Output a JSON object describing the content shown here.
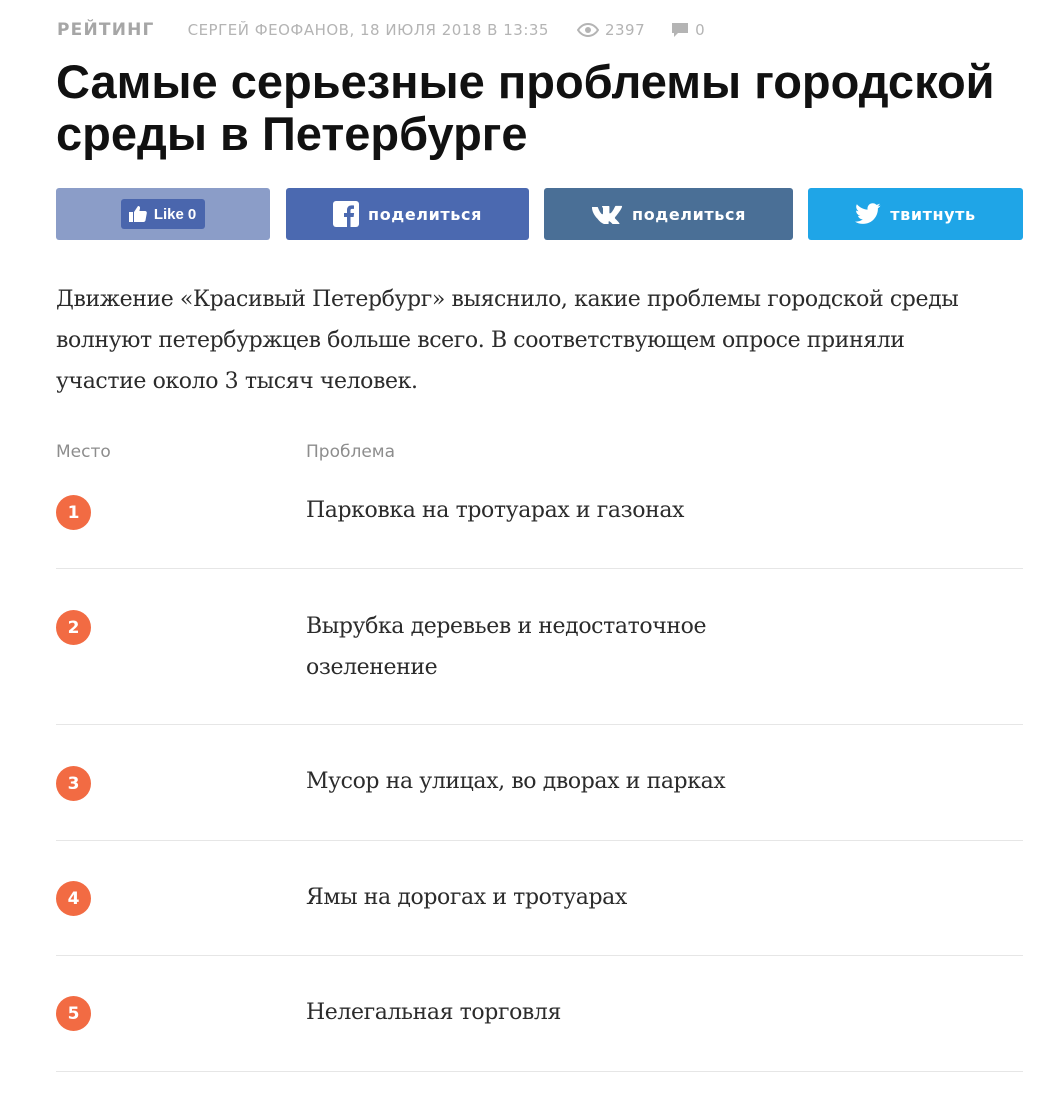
{
  "meta": {
    "category": "РЕЙТИНГ",
    "author_date": "СЕРГЕЙ ФЕОФАНОВ, 18 ИЮЛЯ 2018 В 13:35",
    "views": "2397",
    "comments": "0",
    "views_icon": "eye-icon",
    "comments_icon": "speech-bubble-icon"
  },
  "article": {
    "title": "Самые серьезные проблемы городской среды в Петербурге",
    "lead": "Движение «Красивый Петербург» выяснило, какие проблемы городской среды волнуют петербуржцев больше всего. В соответствующем опросе приняли участие около 3 тысяч человек."
  },
  "share": {
    "like_label": "Like",
    "like_count": "0",
    "facebook_label": "поделиться",
    "vk_label": "поделиться",
    "twitter_label": "твитнуть",
    "colors": {
      "like": "#8b9dc8",
      "facebook": "#4b69b0",
      "vk": "#4a6f96",
      "twitter": "#1fa5e7"
    }
  },
  "table": {
    "headers": [
      "Место",
      "Проблема"
    ],
    "rows": [
      {
        "place": "1",
        "problem": "Парковка на тротуарах и газонах"
      },
      {
        "place": "2",
        "problem": "Вырубка деревьев и недостаточное озеленение"
      },
      {
        "place": "3",
        "problem": "Мусор на улицах, во дворах и парках"
      },
      {
        "place": "4",
        "problem": "Ямы на дорогах и тротуарах"
      },
      {
        "place": "5",
        "problem": "Нелегальная торговля"
      }
    ],
    "badge_color": "#f26b43"
  }
}
